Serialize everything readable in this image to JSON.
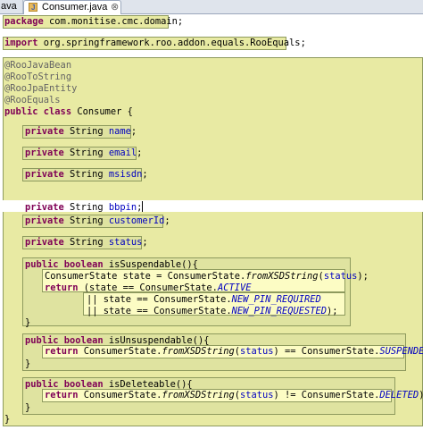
{
  "tabs": [
    {
      "label": "ava",
      "active": false
    },
    {
      "label": "Consumer.java",
      "active": true,
      "close": "⊗"
    }
  ],
  "code": {
    "package_kw": "package",
    "package_name": " com.monitise.cmc.domain;",
    "import_kw": "import",
    "import_name": " org.springframework.roo.addon.equals.RooEquals;",
    "annotations": [
      "@RooJavaBean",
      "@RooToString",
      "@RooJpaEntity",
      "@RooEquals"
    ],
    "class_kw": "public class",
    "class_rest": " Consumer {",
    "fields": [
      {
        "mod": "private",
        "type": " String ",
        "name": "name",
        "end": ";"
      },
      {
        "mod": "private",
        "type": " String ",
        "name": "email",
        "end": ";"
      },
      {
        "mod": "private",
        "type": " String ",
        "name": "msisdn",
        "end": ";"
      },
      {
        "mod": "private",
        "type": " String ",
        "name": "bbpin",
        "end": ";"
      },
      {
        "mod": "private",
        "type": " String ",
        "name": "customerId",
        "end": ";"
      },
      {
        "mod": "private",
        "type": " String ",
        "name": "status",
        "end": ";"
      }
    ],
    "m1_sig_kw": "public boolean",
    "m1_sig_rest": " isSuspendable(){",
    "m1_l1_a": "ConsumerState state = ConsumerState.",
    "m1_l1_b": "fromXSDString",
    "m1_l1_c": "(",
    "m1_l1_d": "status",
    "m1_l1_e": ");",
    "m1_l2_kw": "return",
    "m1_l2_a": " (state == ConsumerState.",
    "m1_l2_b": "ACTIVE",
    "m1_l3_a": "|| state == ConsumerState.",
    "m1_l3_b": "NEW_PIN_REQUIRED",
    "m1_l4_a": "|| state == ConsumerState.",
    "m1_l4_b": "NEW_PIN_REQUESTED",
    "m1_l4_c": ");",
    "close_brace": "}",
    "m2_sig_kw": "public boolean",
    "m2_sig_rest": " isUnsuspendable(){",
    "m2_kw": "return",
    "m2_a": " ConsumerState.",
    "m2_b": "fromXSDString",
    "m2_c": "(",
    "m2_d": "status",
    "m2_e": ") == ConsumerState.",
    "m2_f": "SUSPENDED",
    "m2_g": ");",
    "m3_sig_kw": "public boolean",
    "m3_sig_rest": " isDeleteable(){",
    "m3_kw": "return",
    "m3_a": " ConsumerState.",
    "m3_b": "fromXSDString",
    "m3_c": "(",
    "m3_d": "status",
    "m3_e": ") != ConsumerState.",
    "m3_f": "DELETED",
    "m3_g": ");"
  },
  "colors": {
    "keyword": "#7f0055",
    "field": "#0000c0",
    "annotation": "#646464",
    "scope_outer": "#e8eaa3",
    "scope_inner": "#fcfcc4"
  }
}
